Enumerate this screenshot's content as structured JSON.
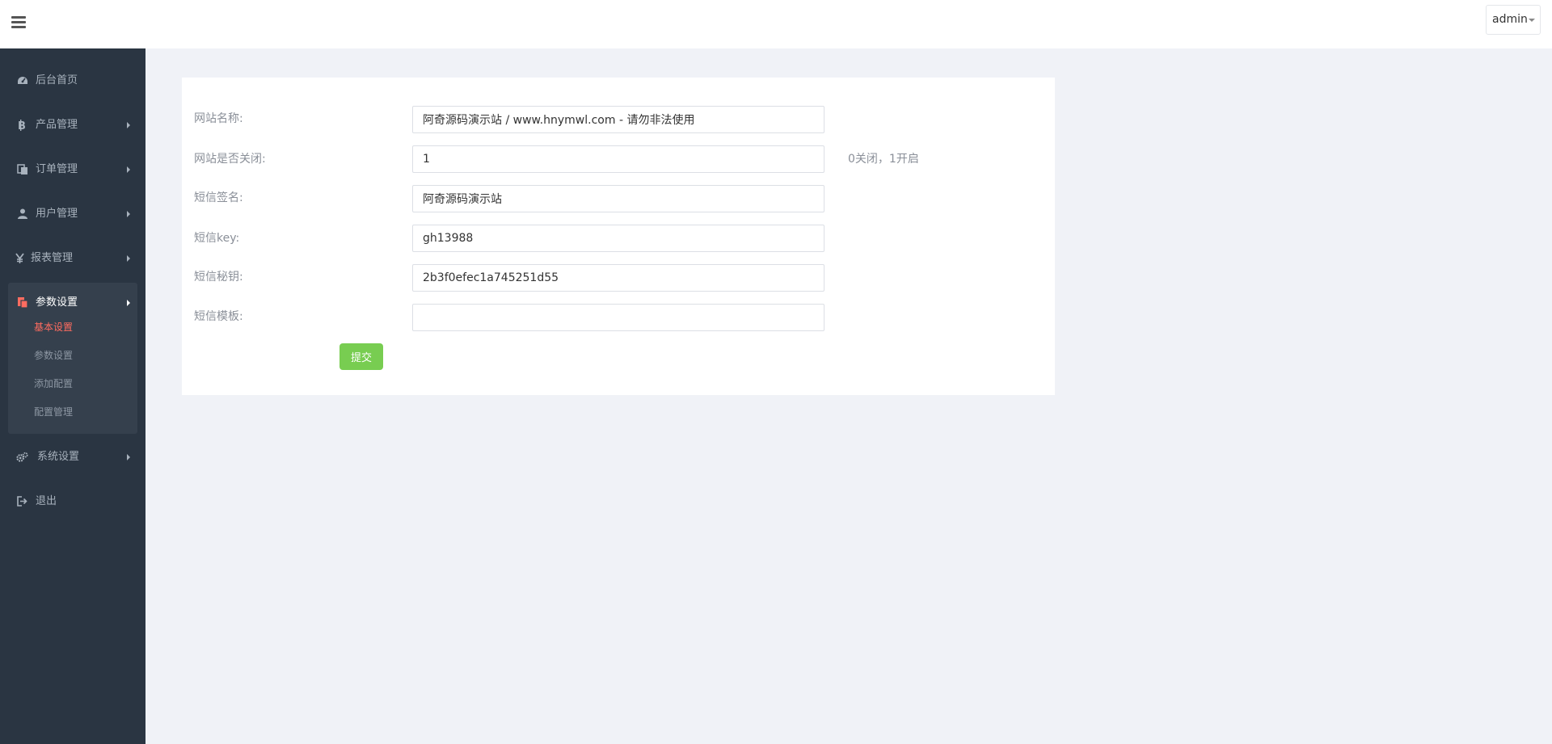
{
  "header": {
    "menu_icon": "hamburger-icon",
    "user_label": "admin"
  },
  "sidebar": {
    "items": [
      {
        "label": "后台首页",
        "icon": "dashboard-icon"
      },
      {
        "label": "产品管理",
        "icon": "bitcoin-icon"
      },
      {
        "label": "订单管理",
        "icon": "copy-icon"
      },
      {
        "label": "用户管理",
        "icon": "user-icon"
      },
      {
        "label": "报表管理",
        "icon": "yen-icon"
      },
      {
        "label": "参数设置",
        "icon": "files-icon"
      },
      {
        "label": "系统设置",
        "icon": "cogs-icon"
      },
      {
        "label": "退出",
        "icon": "sign-out-icon"
      }
    ],
    "sub_items": [
      {
        "label": "基本设置",
        "active": true
      },
      {
        "label": "参数设置",
        "active": false
      },
      {
        "label": "添加配置",
        "active": false
      },
      {
        "label": "配置管理",
        "active": false
      }
    ]
  },
  "form": {
    "fields": [
      {
        "label": "网站名称:",
        "value": "阿奇源码演示站 / www.hnymwl.com - 请勿非法使用"
      },
      {
        "label": "网站是否关闭:",
        "value": "1"
      },
      {
        "label": "短信签名:",
        "value": "阿奇源码演示站"
      },
      {
        "label": "短信key:",
        "value": "gh13988"
      },
      {
        "label": "短信秘钥:",
        "value": "2b3f0efec1a745251d55"
      },
      {
        "label": "短信模板:",
        "value": ""
      }
    ],
    "close_hint": "0关闭，1开启",
    "submit_label": "提交"
  },
  "colors": {
    "sidebar_bg": "#2a3542",
    "active_sub": "#ff6c60",
    "submit_bg": "#78cd51",
    "page_bg": "#f0f2f7"
  }
}
